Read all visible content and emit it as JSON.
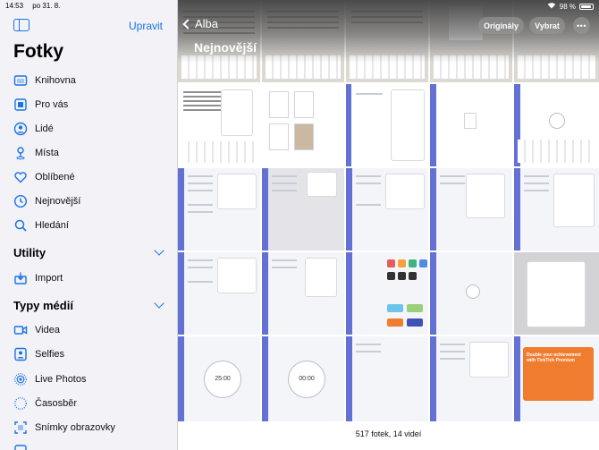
{
  "status": {
    "time": "14:53",
    "date": "po 31. 8.",
    "battery": "98 %"
  },
  "sidebar": {
    "edit_label": "Upravit",
    "title": "Fotky",
    "items": [
      {
        "label": "Knihovna",
        "icon": "library-icon"
      },
      {
        "label": "Pro vás",
        "icon": "for-you-icon"
      },
      {
        "label": "Lidé",
        "icon": "people-icon"
      },
      {
        "label": "Místa",
        "icon": "places-icon"
      },
      {
        "label": "Oblíbené",
        "icon": "heart-icon"
      },
      {
        "label": "Nejnovější",
        "icon": "clock-icon"
      },
      {
        "label": "Hledání",
        "icon": "search-icon"
      }
    ],
    "utility_section": "Utility",
    "utility_items": [
      {
        "label": "Import",
        "icon": "import-icon"
      }
    ],
    "media_section": "Typy médií",
    "media_items": [
      {
        "label": "Videa",
        "icon": "video-icon"
      },
      {
        "label": "Selfies",
        "icon": "selfie-icon"
      },
      {
        "label": "Live Photos",
        "icon": "live-photo-icon"
      },
      {
        "label": "Časosběr",
        "icon": "timelapse-icon"
      },
      {
        "label": "Snímky obrazovky",
        "icon": "screenshot-icon"
      }
    ]
  },
  "main": {
    "back_label": "Alba",
    "title": "Nejnovější",
    "originals_button": "Originály",
    "select_button": "Vybrat",
    "more_button": "•••",
    "footer_count": "517 fotek, 14 videí",
    "tiles": {
      "timer_a": "25:00",
      "timer_b": "00:00",
      "promo": "Double your achievement with TickTick Premium"
    }
  },
  "colors": {
    "accent": "#1a73e8",
    "sidebar_bg": "#f2f2f7",
    "app_bar": "#6471d4",
    "promo": "#f07c2f"
  }
}
